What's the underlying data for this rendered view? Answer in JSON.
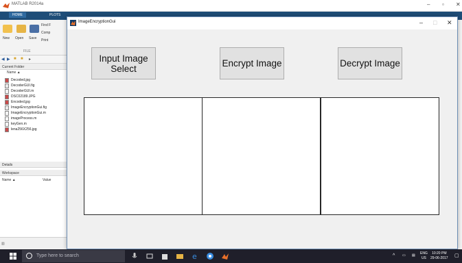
{
  "matlab": {
    "title": "MATLAB R2014a",
    "ribbon_tabs": [
      "HOME",
      "PLOTS"
    ],
    "ribbon_buttons": {
      "new": "New",
      "open": "Open",
      "save": "Save",
      "find": "Find F",
      "compare": "Comp",
      "print": "Print",
      "file_group": "FILE"
    },
    "current_folder_label": "Current Folder",
    "name_column": "Name ▲",
    "files": [
      "Decoded.jpg",
      "DecoderGUI.fig",
      "DecoderGUI.m",
      "DSC02189.JPG",
      "Encoded.jpg",
      "ImageEncryptionGui.fig",
      "ImageEncryptionGui.m",
      "imageProcess.m",
      "keyGen.m",
      "lena256X256.jpg"
    ],
    "details_label": "Details",
    "workspace_label": "Workspace",
    "workspace_columns": [
      "Name ▲",
      "Value"
    ]
  },
  "figure": {
    "title": "ImageEncryptionGui",
    "buttons": {
      "input": "Input Image Select",
      "encrypt": "Encrypt Image",
      "decrypt": "Decrypt Image"
    }
  },
  "taskbar": {
    "search_placeholder": "Type here to search",
    "lang": "ENG",
    "region": "US",
    "time": "10:20 PM",
    "date": "29-06-2017"
  },
  "colors": {
    "figure_bg": "#f0f0f0",
    "button_bg": "#e1e1e1",
    "ribbon_blue": "#1e4d78",
    "taskbar": "#1f1f2a"
  }
}
